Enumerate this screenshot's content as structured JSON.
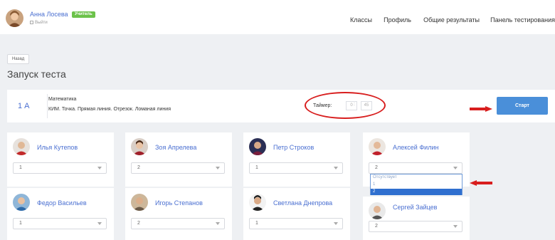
{
  "header": {
    "user_name": "Анна Лосева",
    "role_badge": "Учитель",
    "logout": "Выйти",
    "nav": [
      {
        "label": "Классы"
      },
      {
        "label": "Профиль"
      },
      {
        "label": "Общие результаты"
      },
      {
        "label": "Панель тестирования"
      }
    ]
  },
  "back_label": "Назад",
  "page_title": "Запуск теста",
  "test": {
    "class_label": "1 А",
    "subject": "Математика",
    "topics": "КИМ. Точка. Прямая линия. Отрезок. Ломаная линия",
    "timer_label": "Таймер:",
    "timer_minutes": "0",
    "timer_seconds": "45",
    "start_label": "Старт"
  },
  "students": [
    {
      "name": "Илья Кутепов",
      "value": "1"
    },
    {
      "name": "Зоя Апрелева",
      "value": "2"
    },
    {
      "name": "Петр Строков",
      "value": "1"
    },
    {
      "name": "Алексей Филин",
      "value": "2"
    },
    {
      "name": "Федор Васильев",
      "value": "1"
    },
    {
      "name": "Игорь Степанов",
      "value": "2"
    },
    {
      "name": "Светлана Днепрова",
      "value": "1"
    },
    {
      "name": "Сергей Зайцев",
      "value": "2"
    }
  ],
  "dropdown_options": [
    "Отсутствует",
    "1",
    "2"
  ],
  "colors": {
    "accent": "#4a6fd1",
    "start_button": "#4a8fd9",
    "annotation": "#d81e1e",
    "role_badge": "#6cc24a"
  }
}
